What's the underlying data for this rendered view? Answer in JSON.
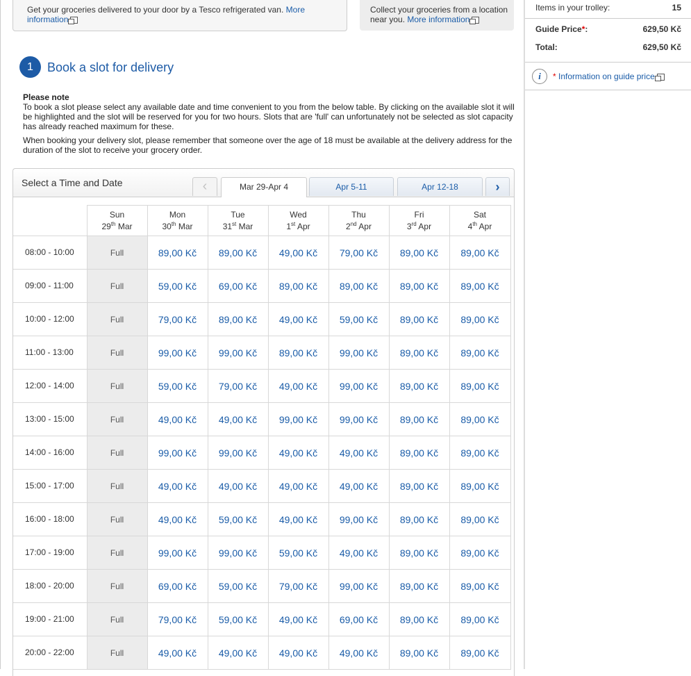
{
  "delivery_option": {
    "text": "Get your groceries delivered to your door by a Tesco refrigerated van.",
    "link": "More information"
  },
  "collect_option": {
    "text": "Collect your groceries from a location near you.",
    "link": "More information"
  },
  "step": {
    "number": "1",
    "title": "Book a slot for delivery"
  },
  "note": {
    "heading": "Please note",
    "para1": "To book a slot please select any available date and time convenient to you from the below table. By clicking on the available slot it will be highlighted and the slot will be reserved for you for two hours. Slots that are 'full' can unfortunately not be selected as slot capacity has already reached maximum for these.",
    "para2": "When booking your delivery slot, please remember that someone over the age of 18 must be available at the delivery address for the duration of the slot to receive your grocery order."
  },
  "slot_picker": {
    "title": "Select a Time and Date",
    "prev_icon": "chevron-left",
    "next_icon": "chevron-right",
    "tabs": [
      "Mar 29-Apr 4",
      "Apr 5-11",
      "Apr 12-18"
    ],
    "active_tab": 0,
    "days": [
      {
        "name": "Sun",
        "day": "29",
        "suffix": "th",
        "month": "Mar"
      },
      {
        "name": "Mon",
        "day": "30",
        "suffix": "th",
        "month": "Mar"
      },
      {
        "name": "Tue",
        "day": "31",
        "suffix": "st",
        "month": "Mar"
      },
      {
        "name": "Wed",
        "day": "1",
        "suffix": "st",
        "month": "Apr"
      },
      {
        "name": "Thu",
        "day": "2",
        "suffix": "nd",
        "month": "Apr"
      },
      {
        "name": "Fri",
        "day": "3",
        "suffix": "rd",
        "month": "Apr"
      },
      {
        "name": "Sat",
        "day": "4",
        "suffix": "th",
        "month": "Apr"
      }
    ],
    "rows": [
      {
        "time": "08:00 - 10:00",
        "slots": [
          "Full",
          "89,00 Kč",
          "89,00 Kč",
          "49,00 Kč",
          "79,00 Kč",
          "89,00 Kč",
          "89,00 Kč"
        ]
      },
      {
        "time": "09:00 - 11:00",
        "slots": [
          "Full",
          "59,00 Kč",
          "69,00 Kč",
          "89,00 Kč",
          "89,00 Kč",
          "89,00 Kč",
          "89,00 Kč"
        ]
      },
      {
        "time": "10:00 - 12:00",
        "slots": [
          "Full",
          "79,00 Kč",
          "89,00 Kč",
          "49,00 Kč",
          "59,00 Kč",
          "89,00 Kč",
          "89,00 Kč"
        ]
      },
      {
        "time": "11:00 - 13:00",
        "slots": [
          "Full",
          "99,00 Kč",
          "99,00 Kč",
          "89,00 Kč",
          "99,00 Kč",
          "89,00 Kč",
          "89,00 Kč"
        ]
      },
      {
        "time": "12:00 - 14:00",
        "slots": [
          "Full",
          "59,00 Kč",
          "79,00 Kč",
          "49,00 Kč",
          "99,00 Kč",
          "89,00 Kč",
          "89,00 Kč"
        ]
      },
      {
        "time": "13:00 - 15:00",
        "slots": [
          "Full",
          "49,00 Kč",
          "49,00 Kč",
          "99,00 Kč",
          "99,00 Kč",
          "89,00 Kč",
          "89,00 Kč"
        ]
      },
      {
        "time": "14:00 - 16:00",
        "slots": [
          "Full",
          "99,00 Kč",
          "99,00 Kč",
          "49,00 Kč",
          "49,00 Kč",
          "89,00 Kč",
          "89,00 Kč"
        ]
      },
      {
        "time": "15:00 - 17:00",
        "slots": [
          "Full",
          "49,00 Kč",
          "49,00 Kč",
          "49,00 Kč",
          "49,00 Kč",
          "89,00 Kč",
          "89,00 Kč"
        ]
      },
      {
        "time": "16:00 - 18:00",
        "slots": [
          "Full",
          "49,00 Kč",
          "59,00 Kč",
          "49,00 Kč",
          "99,00 Kč",
          "89,00 Kč",
          "89,00 Kč"
        ]
      },
      {
        "time": "17:00 - 19:00",
        "slots": [
          "Full",
          "99,00 Kč",
          "99,00 Kč",
          "59,00 Kč",
          "49,00 Kč",
          "89,00 Kč",
          "89,00 Kč"
        ]
      },
      {
        "time": "18:00 - 20:00",
        "slots": [
          "Full",
          "69,00 Kč",
          "59,00 Kč",
          "79,00 Kč",
          "99,00 Kč",
          "89,00 Kč",
          "89,00 Kč"
        ]
      },
      {
        "time": "19:00 - 21:00",
        "slots": [
          "Full",
          "79,00 Kč",
          "59,00 Kč",
          "49,00 Kč",
          "69,00 Kč",
          "89,00 Kč",
          "89,00 Kč"
        ]
      },
      {
        "time": "20:00 - 22:00",
        "slots": [
          "Full",
          "49,00 Kč",
          "49,00 Kč",
          "49,00 Kč",
          "49,00 Kč",
          "89,00 Kč",
          "89,00 Kč"
        ]
      }
    ]
  },
  "trolley": {
    "items_label": "Items in your trolley:",
    "items_value": "15",
    "guide_label": "Guide Price",
    "guide_star": "*",
    "guide_colon": ":",
    "guide_value": "629,50 Kč",
    "total_label": "Total:",
    "total_value": "629,50 Kč",
    "info_star": "*",
    "info_link": "Information on guide price"
  },
  "colors": {
    "accent": "#1d5ba6",
    "link": "#1a5ca8",
    "full_bg": "#ececec"
  }
}
